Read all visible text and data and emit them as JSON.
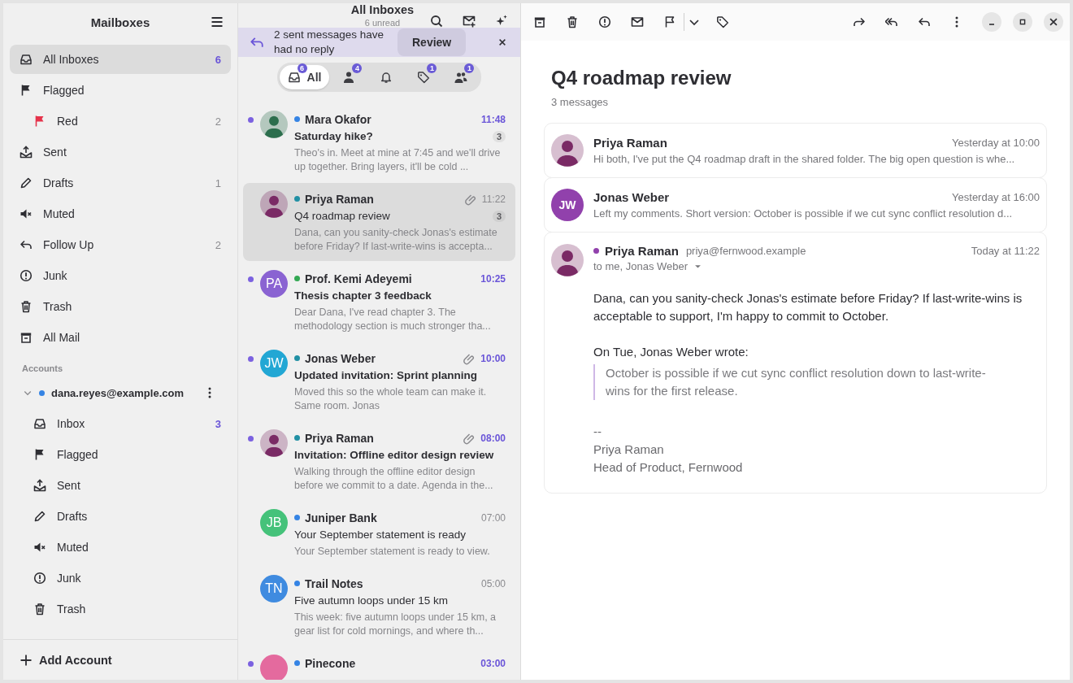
{
  "sidebar": {
    "title": "Mailboxes",
    "mailboxes": [
      {
        "kind": "inbox",
        "label": "All Inboxes",
        "count": "6",
        "unread": true,
        "selected": true
      },
      {
        "kind": "flag",
        "label": "Flagged",
        "selected": false,
        "children": [
          {
            "kind": "flag",
            "label": "Red",
            "count": "2",
            "unread": false,
            "selected": false,
            "color": "#e5334b"
          }
        ]
      },
      {
        "kind": "sent",
        "label": "Sent",
        "selected": false
      },
      {
        "kind": "drafts",
        "label": "Drafts",
        "count": "1",
        "unread": false,
        "selected": false
      },
      {
        "kind": "muted",
        "label": "Muted",
        "selected": false
      },
      {
        "kind": "reply",
        "label": "Follow Up",
        "count": "2",
        "unread": false,
        "selected": false
      },
      {
        "kind": "junk",
        "label": "Junk",
        "selected": false
      },
      {
        "kind": "trash",
        "label": "Trash",
        "selected": false
      },
      {
        "kind": "archive",
        "label": "All Mail",
        "selected": false
      }
    ],
    "accounts_label": "Accounts",
    "account": {
      "address": "dana.reyes@example.com",
      "color": "#3584e4",
      "expanded": true,
      "folders": [
        {
          "kind": "inbox",
          "label": "Inbox",
          "count": "3",
          "unread": true,
          "selected": false
        },
        {
          "kind": "flag",
          "label": "Flagged",
          "selected": false
        },
        {
          "kind": "sent",
          "label": "Sent",
          "selected": false
        },
        {
          "kind": "drafts",
          "label": "Drafts",
          "selected": false
        },
        {
          "kind": "muted",
          "label": "Muted",
          "selected": false
        },
        {
          "kind": "junk",
          "label": "Junk",
          "selected": false
        },
        {
          "kind": "trash",
          "label": "Trash",
          "selected": false
        }
      ]
    },
    "add_account": "Add Account"
  },
  "message_list": {
    "title": "All Inboxes",
    "subtitle": "6 unread",
    "banner": {
      "text": "2 sent messages have had no reply",
      "button": "Review"
    },
    "filters": [
      {
        "kind": "inbox",
        "label": "All",
        "badge": "6",
        "selected": true
      },
      {
        "kind": "person",
        "badge": "4",
        "selected": false
      },
      {
        "kind": "bell",
        "selected": false
      },
      {
        "kind": "tag",
        "badge": "1",
        "selected": false
      },
      {
        "kind": "group",
        "badge": "1",
        "selected": false
      }
    ],
    "messages": [
      {
        "sender": "Mara Okafor",
        "color": "#3584e4",
        "time": "11:48",
        "subject": "Saturday hike?",
        "thread_count": "3",
        "preview": "Theo's in. Meet at mine at 7:45 and we'll drive up together. Bring layers, it'll be cold ...",
        "unread": true,
        "selected": false,
        "attachment": false,
        "avatar": {
          "kind": "figure",
          "color": "#2c6e4d"
        }
      },
      {
        "sender": "Priya Raman",
        "color": "#2190a4",
        "time": "11:22",
        "subject": "Q4 roadmap review",
        "thread_count": "3",
        "preview": "Dana, can you sanity-check Jonas's estimate before Friday? If last-write-wins is accepta...",
        "unread": false,
        "selected": true,
        "attachment": true,
        "avatar": {
          "kind": "figure",
          "color": "#7a2a65"
        }
      },
      {
        "sender": "Prof. Kemi Adeyemi",
        "color": "#33a853",
        "time": "10:25",
        "subject": "Thesis chapter 3 feedback",
        "preview": "Dear Dana, I've read chapter 3. The methodology section is much stronger tha...",
        "unread": true,
        "selected": false,
        "attachment": false,
        "avatar": {
          "kind": "initials",
          "initials": "PA",
          "color": "#8a63d2"
        }
      },
      {
        "sender": "Jonas Weber",
        "color": "#2190a4",
        "time": "10:00",
        "subject": "Updated invitation: Sprint planning",
        "preview": "Moved this so the whole team can make it. Same room. Jonas",
        "unread": true,
        "selected": false,
        "attachment": true,
        "avatar": {
          "kind": "initials",
          "initials": "JW",
          "color": "#22a7d4"
        }
      },
      {
        "sender": "Priya Raman",
        "color": "#2190a4",
        "time": "08:00",
        "subject": "Invitation: Offline editor design review",
        "preview": "Walking through the offline editor design before we commit to a date. Agenda in the...",
        "unread": true,
        "selected": false,
        "attachment": true,
        "avatar": {
          "kind": "figure",
          "color": "#7a2a65"
        }
      },
      {
        "sender": "Juniper Bank",
        "color": "#3584e4",
        "time": "07:00",
        "subject": "Your September statement is ready",
        "preview": "Your September statement is ready to view.",
        "unread": false,
        "selected": false,
        "attachment": false,
        "avatar": {
          "kind": "initials",
          "initials": "JB",
          "color": "#45c27a"
        }
      },
      {
        "sender": "Trail Notes",
        "color": "#3584e4",
        "time": "05:00",
        "subject": "Five autumn loops under 15 km",
        "preview": "This week: five autumn loops under 15 km, a gear list for cold mornings, and where th...",
        "unread": false,
        "selected": false,
        "attachment": false,
        "avatar": {
          "kind": "initials",
          "color": "#3f8be0",
          "initials": "TN"
        }
      },
      {
        "sender": "Pinecone",
        "color": "#3584e4",
        "time": "03:00",
        "unread": true,
        "selected": false,
        "attachment": false,
        "avatar": {
          "kind": "initials",
          "color": "#e46a9e"
        }
      }
    ]
  },
  "reader": {
    "subject": "Q4 roadmap review",
    "count": "3 messages",
    "collapsed": [
      {
        "sender": "Priya Raman",
        "time": "Yesterday at 10:00",
        "preview": "Hi both, I've put the Q4 roadmap draft in the shared folder. The big open question is whe...",
        "avatar": {
          "kind": "figure",
          "color": "#7a2a65"
        }
      },
      {
        "sender": "Jonas Weber",
        "time": "Yesterday at 16:00",
        "preview": "Left my comments. Short version: October is possible if we cut sync conflict resolution d...",
        "avatar": {
          "kind": "initials",
          "initials": "JW",
          "color": "#9141ac"
        }
      }
    ],
    "open": {
      "sender": "Priya Raman",
      "color": "#9141ac",
      "email": "priya@fernwood.example",
      "to": "to me, Jonas Weber",
      "time": "Today at 11:22",
      "avatar": {
        "kind": "figure",
        "color": "#7a2a65"
      },
      "body": "Dana, can you sanity-check Jonas's estimate before Friday? If last-write-wins is acceptable to support, I'm happy to commit to October.",
      "quote_intro": "On Tue, Jonas Weber wrote:",
      "quote": "October is possible if we cut sync conflict resolution down to last-write-wins for the first release.",
      "signature": [
        "--",
        "Priya Raman",
        "Head of Product, Fernwood"
      ]
    }
  }
}
